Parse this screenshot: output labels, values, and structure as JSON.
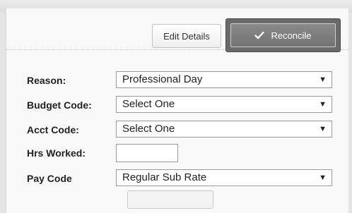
{
  "toolbar": {
    "edit_details_label": "Edit Details",
    "reconcile_label": "Reconcile",
    "reconcile_icon": "check-icon"
  },
  "form": {
    "reason": {
      "label": "Reason:",
      "value": "Professional Day"
    },
    "budget_code": {
      "label": "Budget Code:",
      "value": "Select One"
    },
    "acct_code": {
      "label": "Acct Code:",
      "value": "Select One"
    },
    "hrs_worked": {
      "label": "Hrs Worked:",
      "value": ""
    },
    "pay_code": {
      "label": "Pay Code",
      "value": "Regular Sub Rate"
    }
  },
  "colors": {
    "reconcile_button": "#7d7d7d",
    "panel_background": "#f9f9f9"
  }
}
